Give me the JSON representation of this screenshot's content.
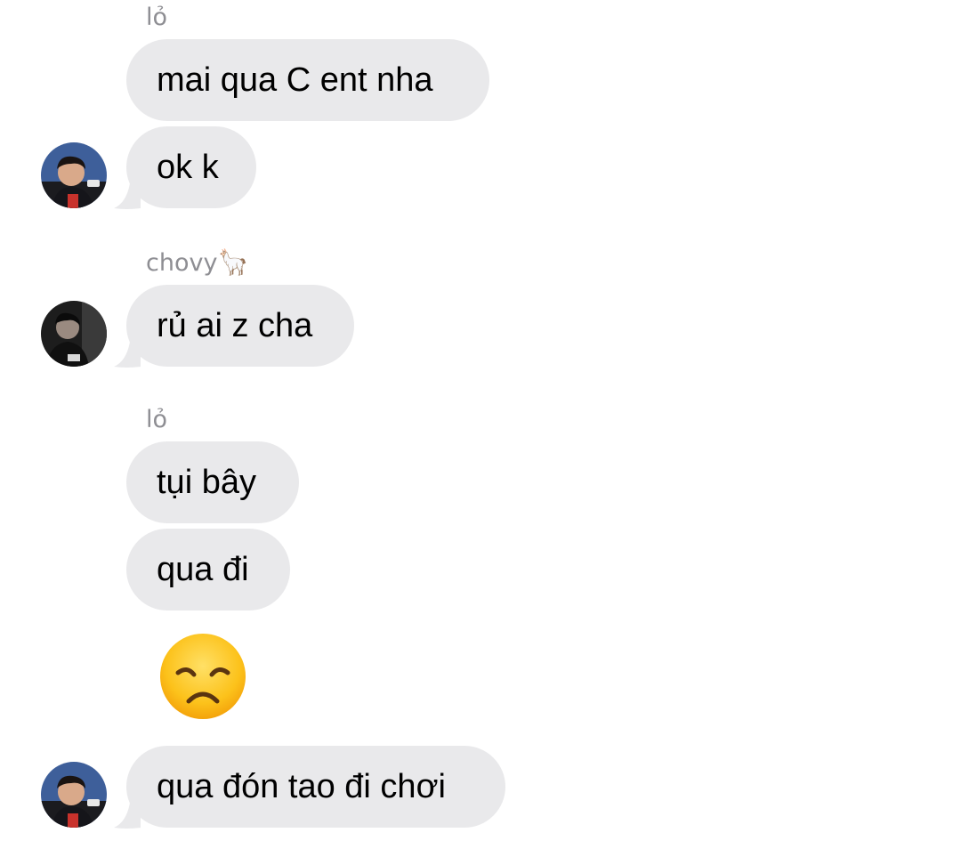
{
  "messages": [
    {
      "sender": "lỏ",
      "text": "mai qua C ent nha"
    },
    {
      "text": "ok k"
    },
    {
      "sender": "chovy",
      "sender_emoji": "🦙",
      "text": "rủ ai z cha"
    },
    {
      "sender": "lỏ",
      "text": "tụi bây"
    },
    {
      "text": "qua đi"
    },
    {
      "emoji": "disappointed-face"
    },
    {
      "text": "qua đón tao đi chơi"
    }
  ],
  "colors": {
    "bubble": "#e9e9eb",
    "sender_name": "#8e8e93",
    "text": "#000000"
  }
}
